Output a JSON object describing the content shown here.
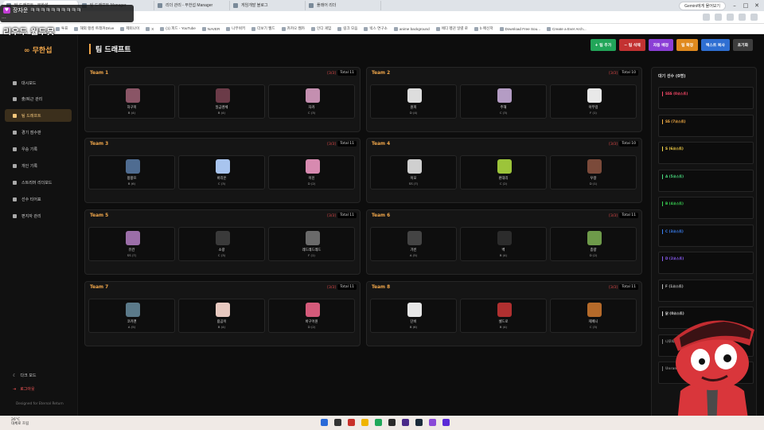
{
  "browser": {
    "tabs": [
      "팀 드래프트 - 무한섭",
      "팀 드래프트 Manager",
      "리더 관리 - 무한섭 Manager",
      "게임개발 블로그",
      "플래어 리더"
    ],
    "gemini_button": "Gemini에게 물어보기",
    "bookmarks": [
      "투표",
      "해외 랭킹 트래커Drive",
      "제미나이",
      "X",
      "(1) 피드 - YouTube",
      "NAVER",
      "나무위키",
      "더보기 웹드",
      "카카오 웹카",
      "인디 게임",
      "링크 모음",
      "빅스 연구소",
      "anime background",
      "에디 펭귄 일렬 로",
      "b 메신저",
      "Download Free Sou...",
      "Create a Ever Arch..."
    ]
  },
  "stream": {
    "line1": "장자운 ㅋㅋㅋㅋㅋㅋㅋㅋㅋㅋ",
    "line2": "...",
    "nickname": "리우두 월두뭉"
  },
  "app": {
    "logo": "∞ 무한섭",
    "title": "팀 드래프트",
    "nav": [
      {
        "label": "대시보드",
        "icon": "home-icon"
      },
      {
        "label": "출/퇴근 관리",
        "icon": "clipboard-icon"
      },
      {
        "label": "팀 드래프트",
        "icon": "crown-icon"
      },
      {
        "label": "경기 점수판",
        "icon": "trophy-icon"
      },
      {
        "label": "우승 기록",
        "icon": "trophy-icon"
      },
      {
        "label": "개인 기록",
        "icon": "user-icon"
      },
      {
        "label": "스트리머 리더보드",
        "icon": "chart-icon"
      },
      {
        "label": "선수 티어표",
        "icon": "list-icon"
      },
      {
        "label": "편지자 관리",
        "icon": "mail-icon"
      }
    ],
    "dark_mode": "다크 모드",
    "logout": "로그아웃",
    "designed": "Designed for Eternal Return"
  },
  "toolbar": [
    {
      "label": "+ 팀 추가",
      "color": "#22a559"
    },
    {
      "label": "− 팀 삭제",
      "color": "#c33232"
    },
    {
      "label": "자동 배정",
      "color": "#8b3fd6"
    },
    {
      "label": "팀 확정",
      "color": "#e08a1e"
    },
    {
      "label": "텍스트 복사",
      "color": "#2f6fd2"
    },
    {
      "label": "초기화",
      "color": "#3d3d3d"
    }
  ],
  "teams": [
    {
      "name": "Team 1",
      "count": "[3/3]",
      "total": "Total 11",
      "members": [
        {
          "name": "하구미",
          "tier": "B (4)",
          "color": "#8a5566"
        },
        {
          "name": "일급렌체",
          "tier": "B (4)",
          "color": "#6b3b48"
        },
        {
          "name": "자카",
          "tier": "C (3)",
          "color": "#c48fb0"
        }
      ]
    },
    {
      "name": "Team 2",
      "count": "[3/3]",
      "total": "Total 10",
      "members": [
        {
          "name": "원피",
          "tier": "D (4)",
          "color": "#dddddd"
        },
        {
          "name": "주해",
          "tier": "C (3)",
          "color": "#b49cc4"
        },
        {
          "name": "아무렁",
          "tier": "F (1)",
          "color": "#e8e8e8"
        }
      ]
    },
    {
      "name": "Team 3",
      "count": "[3/3]",
      "total": "Total 11",
      "members": [
        {
          "name": "팡팡프",
          "tier": "B (6)",
          "color": "#4f6c91"
        },
        {
          "name": "바리온",
          "tier": "C (3)",
          "color": "#a8c4ee"
        },
        {
          "name": "이진",
          "tier": "D (2)",
          "color": "#d78ab0"
        }
      ]
    },
    {
      "name": "Team 4",
      "count": "[3/3]",
      "total": "Total 10",
      "members": [
        {
          "name": "이모",
          "tier": "SS (7)",
          "color": "#cfcfcf"
        },
        {
          "name": "판대리",
          "tier": "C (2)",
          "color": "#9cc43a"
        },
        {
          "name": "우왕",
          "tier": "D (1)",
          "color": "#7b4a3a"
        }
      ]
    },
    {
      "name": "Team 5",
      "count": "[3/3]",
      "total": "Total 11",
      "members": [
        {
          "name": "유칸",
          "tier": "SS (7)",
          "color": "#9b6ea8"
        },
        {
          "name": "소랑",
          "tier": "C (3)",
          "color": "#3a3a3a"
        },
        {
          "name": "레드레드레드",
          "tier": "F (1)",
          "color": "#6a6a6a"
        }
      ]
    },
    {
      "name": "Team 6",
      "count": "[3/3]",
      "total": "Total 11",
      "members": [
        {
          "name": "가빈",
          "tier": "A (5)",
          "color": "#444444"
        },
        {
          "name": "벡",
          "tier": "B (4)",
          "color": "#2c2c2c"
        },
        {
          "name": "종량",
          "tier": "D (2)",
          "color": "#6e9a4a"
        }
      ]
    },
    {
      "name": "Team 7",
      "count": "[3/3]",
      "total": "Total 11",
      "members": [
        {
          "name": "코카맨",
          "tier": "A (5)",
          "color": "#5b7a8a"
        },
        {
          "name": "람곰이",
          "tier": "B (4)",
          "color": "#e8c9c0"
        },
        {
          "name": "바구어원",
          "tier": "D (2)",
          "color": "#d45a7a"
        }
      ]
    },
    {
      "name": "Team 8",
      "count": "[3/3]",
      "total": "Total 11",
      "members": [
        {
          "name": "단비",
          "tier": "B (6)",
          "color": "#e6e6e6"
        },
        {
          "name": "셀드로",
          "tier": "B (4)",
          "color": "#b03030"
        },
        {
          "name": "제페니",
          "tier": "C (3)",
          "color": "#b56a2a"
        }
      ]
    }
  ],
  "waiting": {
    "title": "대기 선수 (0명)",
    "tiers": [
      {
        "label": "SSS (0코스트)",
        "color": "#ff4a6a"
      },
      {
        "label": "SS (7코스트)",
        "color": "#ffb347"
      },
      {
        "label": "S (6코스트)",
        "color": "#ffd84a"
      },
      {
        "label": "A (5코스트)",
        "color": "#4ade80"
      },
      {
        "label": "B (4코스트)",
        "color": "#39d353"
      },
      {
        "label": "C (3코스트)",
        "color": "#3b82f6"
      },
      {
        "label": "D (2코스트)",
        "color": "#8b5cf6"
      },
      {
        "label": "F (1코스트)",
        "color": "#bbbbbb"
      },
      {
        "label": "닭 (0코스트)",
        "color": "#dddddd"
      },
      {
        "label": "나무의",
        "color": "#888888"
      },
      {
        "label": "Unranked (0코스트)",
        "color": "#777777"
      }
    ]
  },
  "taskbar": {
    "weather_temp": "26°C",
    "weather_desc": "대체로 흐림"
  }
}
